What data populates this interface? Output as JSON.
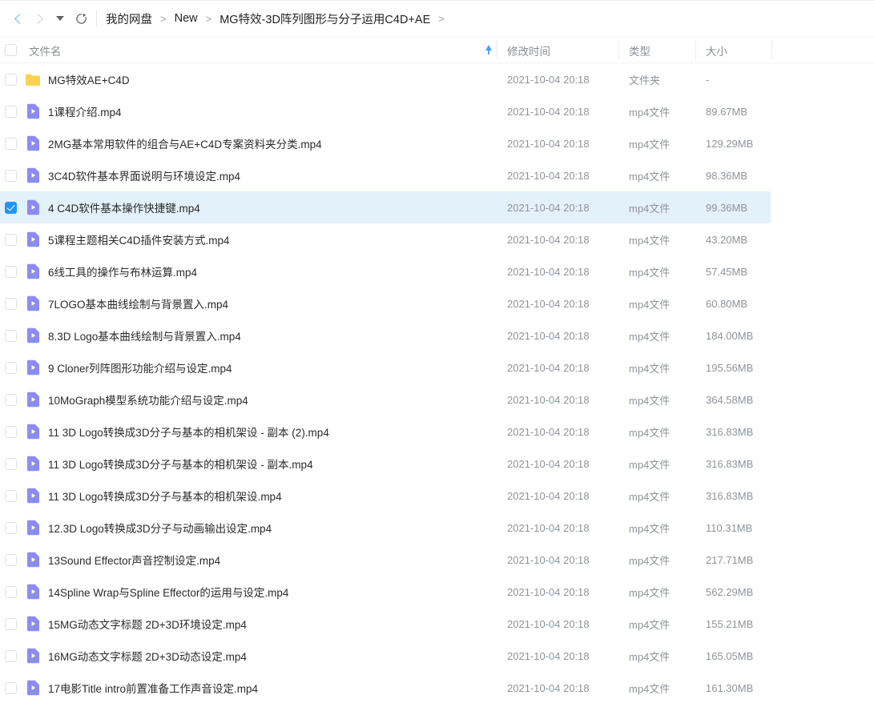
{
  "toolbar": {
    "back_icon": "chevron-left-icon",
    "forward_icon": "chevron-right-icon",
    "dropdown_icon": "chevron-down-icon",
    "refresh_icon": "refresh-icon",
    "breadcrumb": [
      {
        "label": "我的网盘"
      },
      {
        "label": "New"
      },
      {
        "label": "MG特效-3D阵列图形与分子运用C4D+AE"
      }
    ],
    "breadcrumb_separator": ">",
    "breadcrumb_trailing": ">"
  },
  "table": {
    "columns": {
      "name": "文件名",
      "modified": "修改时间",
      "type": "类型",
      "size": "大小"
    },
    "sort": {
      "column": "文件名",
      "direction": "asc",
      "icon": "sort-ascending-icon"
    },
    "select_all_checked": false,
    "rows": [
      {
        "name": "MG特效AE+C4D",
        "modified": "2021-10-04 20:18",
        "type": "文件夹",
        "size": "-",
        "icon": "folder-icon",
        "selected": false
      },
      {
        "name": "1课程介绍.mp4",
        "modified": "2021-10-04 20:18",
        "type": "mp4文件",
        "size": "89.67MB",
        "icon": "video-file-icon",
        "selected": false
      },
      {
        "name": "2MG基本常用软件的组合与AE+C4D专案资料夹分类.mp4",
        "modified": "2021-10-04 20:18",
        "type": "mp4文件",
        "size": "129.29MB",
        "icon": "video-file-icon",
        "selected": false
      },
      {
        "name": "3C4D软件基本界面说明与环境设定.mp4",
        "modified": "2021-10-04 20:18",
        "type": "mp4文件",
        "size": "98.36MB",
        "icon": "video-file-icon",
        "selected": false
      },
      {
        "name": "4 C4D软件基本操作快捷键.mp4",
        "modified": "2021-10-04 20:18",
        "type": "mp4文件",
        "size": "99.36MB",
        "icon": "video-file-icon",
        "selected": true
      },
      {
        "name": "5课程主题相关C4D插件安装方式.mp4",
        "modified": "2021-10-04 20:18",
        "type": "mp4文件",
        "size": "43.20MB",
        "icon": "video-file-icon",
        "selected": false
      },
      {
        "name": "6线工具的操作与布林运算.mp4",
        "modified": "2021-10-04 20:18",
        "type": "mp4文件",
        "size": "57.45MB",
        "icon": "video-file-icon",
        "selected": false
      },
      {
        "name": "7LOGO基本曲线绘制与背景置入.mp4",
        "modified": "2021-10-04 20:18",
        "type": "mp4文件",
        "size": "60.80MB",
        "icon": "video-file-icon",
        "selected": false
      },
      {
        "name": "8.3D Logo基本曲线绘制与背景置入.mp4",
        "modified": "2021-10-04 20:18",
        "type": "mp4文件",
        "size": "184.00MB",
        "icon": "video-file-icon",
        "selected": false
      },
      {
        "name": "9 Cloner列阵图形功能介绍与设定.mp4",
        "modified": "2021-10-04 20:18",
        "type": "mp4文件",
        "size": "195.56MB",
        "icon": "video-file-icon",
        "selected": false
      },
      {
        "name": "10MoGraph模型系统功能介绍与设定.mp4",
        "modified": "2021-10-04 20:18",
        "type": "mp4文件",
        "size": "364.58MB",
        "icon": "video-file-icon",
        "selected": false
      },
      {
        "name": "11 3D Logo转换成3D分子与基本的相机架设 - 副本 (2).mp4",
        "modified": "2021-10-04 20:18",
        "type": "mp4文件",
        "size": "316.83MB",
        "icon": "video-file-icon",
        "selected": false
      },
      {
        "name": "11 3D Logo转换成3D分子与基本的相机架设 - 副本.mp4",
        "modified": "2021-10-04 20:18",
        "type": "mp4文件",
        "size": "316.83MB",
        "icon": "video-file-icon",
        "selected": false
      },
      {
        "name": "11 3D Logo转换成3D分子与基本的相机架设.mp4",
        "modified": "2021-10-04 20:18",
        "type": "mp4文件",
        "size": "316.83MB",
        "icon": "video-file-icon",
        "selected": false
      },
      {
        "name": "12.3D Logo转换成3D分子与动画输出设定.mp4",
        "modified": "2021-10-04 20:18",
        "type": "mp4文件",
        "size": "110.31MB",
        "icon": "video-file-icon",
        "selected": false
      },
      {
        "name": "13Sound Effector声音控制设定.mp4",
        "modified": "2021-10-04 20:18",
        "type": "mp4文件",
        "size": "217.71MB",
        "icon": "video-file-icon",
        "selected": false
      },
      {
        "name": "14Spline Wrap与Spline Effector的运用与设定.mp4",
        "modified": "2021-10-04 20:18",
        "type": "mp4文件",
        "size": "562.29MB",
        "icon": "video-file-icon",
        "selected": false
      },
      {
        "name": "15MG动态文字标题 2D+3D环境设定.mp4",
        "modified": "2021-10-04 20:18",
        "type": "mp4文件",
        "size": "155.21MB",
        "icon": "video-file-icon",
        "selected": false
      },
      {
        "name": "16MG动态文字标题 2D+3D动态设定.mp4",
        "modified": "2021-10-04 20:18",
        "type": "mp4文件",
        "size": "165.05MB",
        "icon": "video-file-icon",
        "selected": false
      },
      {
        "name": "17电影Title intro前置准备工作声音设定.mp4",
        "modified": "2021-10-04 20:18",
        "type": "mp4文件",
        "size": "161.30MB",
        "icon": "video-file-icon",
        "selected": false
      }
    ]
  },
  "colors": {
    "folder": "#fcd050",
    "video": "#8c8cf0",
    "accent": "#2196f3",
    "selected_row": "#e3f1fb"
  }
}
